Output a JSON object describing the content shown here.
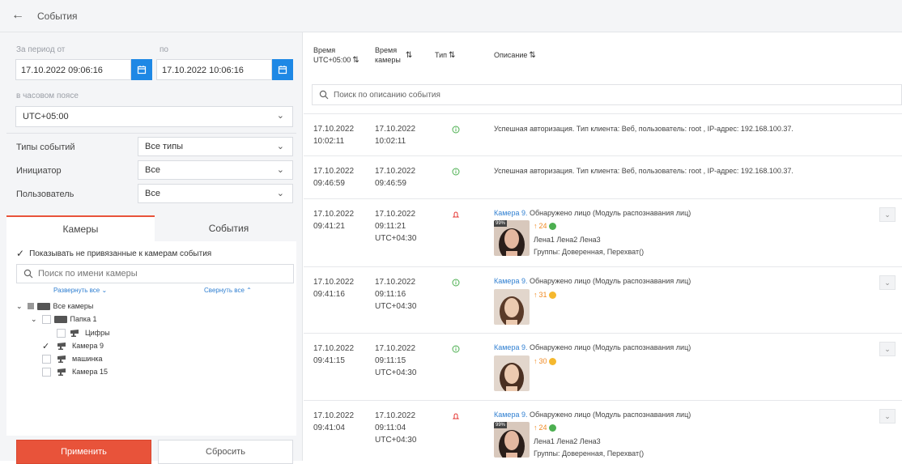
{
  "header": {
    "back_icon": "arrow-left-icon",
    "title": "События"
  },
  "filters": {
    "period_from_label": "За период от",
    "period_to_label": "по",
    "from_value": "17.10.2022 09:06:16",
    "to_value": "17.10.2022 10:06:16",
    "timezone_label": "в часовом поясе",
    "timezone_value": "UTC+05:00",
    "event_types_label": "Типы событий",
    "event_types_value": "Все типы",
    "initiator_label": "Инициатор",
    "initiator_value": "Все",
    "user_label": "Пользователь",
    "user_value": "Все"
  },
  "tabs": {
    "cameras": "Камеры",
    "events": "События"
  },
  "camera_panel": {
    "show_unbound_label": "Показывать не привязанные к камерам события",
    "search_placeholder": "Поиск по имени камеры",
    "expand_all": "Развернуть все",
    "collapse_all": "Свернуть все",
    "tree": {
      "all": "Все камеры",
      "folder1": "Папка 1",
      "cam_digits": "Цифры",
      "cam9": "Камера 9",
      "cam_car": "машинка",
      "cam15": "Камера 15"
    }
  },
  "buttons": {
    "apply": "Применить",
    "reset": "Сбросить"
  },
  "table": {
    "col_time": "Время",
    "col_time_tz": "UTC+05:00",
    "col_cam_time": "Время",
    "col_cam_time2": "камеры",
    "col_type": "Тип",
    "col_desc": "Описание",
    "search_placeholder": "Поиск по описанию события"
  },
  "rows": [
    {
      "date": "17.10.2022",
      "time": "10:02:11",
      "cdate": "17.10.2022",
      "ctime": "10:02:11",
      "ctz": "",
      "type": "info",
      "desc": "Успешная авторизация. Тип клиента: Веб, пользователь: root , IP-адрес: 192.168.100.37."
    },
    {
      "date": "17.10.2022",
      "time": "09:46:59",
      "cdate": "17.10.2022",
      "ctime": "09:46:59",
      "ctz": "",
      "type": "info",
      "desc": "Успешная авторизация. Тип клиента: Веб, пользователь: root , IP-адрес: 192.168.100.37."
    },
    {
      "date": "17.10.2022",
      "time": "09:41:21",
      "cdate": "17.10.2022",
      "ctime": "09:11:21",
      "ctz": "UTC+04:30",
      "type": "alarm",
      "camera": "Камера 9.",
      "desc": "Обнаружено лицо (Модуль распознавания лиц)",
      "badge": "99%",
      "age": "24",
      "dot": "#4caf50",
      "names": "Лена1 Лена2 Лена3",
      "groups": "Группы: Доверенная, Перехват()"
    },
    {
      "date": "17.10.2022",
      "time": "09:41:16",
      "cdate": "17.10.2022",
      "ctime": "09:11:16",
      "ctz": "UTC+04:30",
      "type": "info",
      "camera": "Камера 9.",
      "desc": "Обнаружено лицо (Модуль распознавания лиц)",
      "age": "31",
      "dot": "#f5b82e"
    },
    {
      "date": "17.10.2022",
      "time": "09:41:15",
      "cdate": "17.10.2022",
      "ctime": "09:11:15",
      "ctz": "UTC+04:30",
      "type": "info",
      "camera": "Камера 9.",
      "desc": "Обнаружено лицо (Модуль распознавания лиц)",
      "age": "30",
      "dot": "#f5b82e"
    },
    {
      "date": "17.10.2022",
      "time": "09:41:04",
      "cdate": "17.10.2022",
      "ctime": "09:11:04",
      "ctz": "UTC+04:30",
      "type": "alarm",
      "camera": "Камера 9.",
      "desc": "Обнаружено лицо (Модуль распознавания лиц)",
      "badge": "99%",
      "age": "24",
      "dot": "#4caf50",
      "names": "Лена1 Лена2 Лена3",
      "groups": "Группы: Доверенная, Перехват()"
    }
  ],
  "colors": {
    "accent": "#e8533a",
    "blue": "#1e88e5",
    "link": "#2f7fd1",
    "info": "#4caf50",
    "alarm": "#e53935"
  }
}
